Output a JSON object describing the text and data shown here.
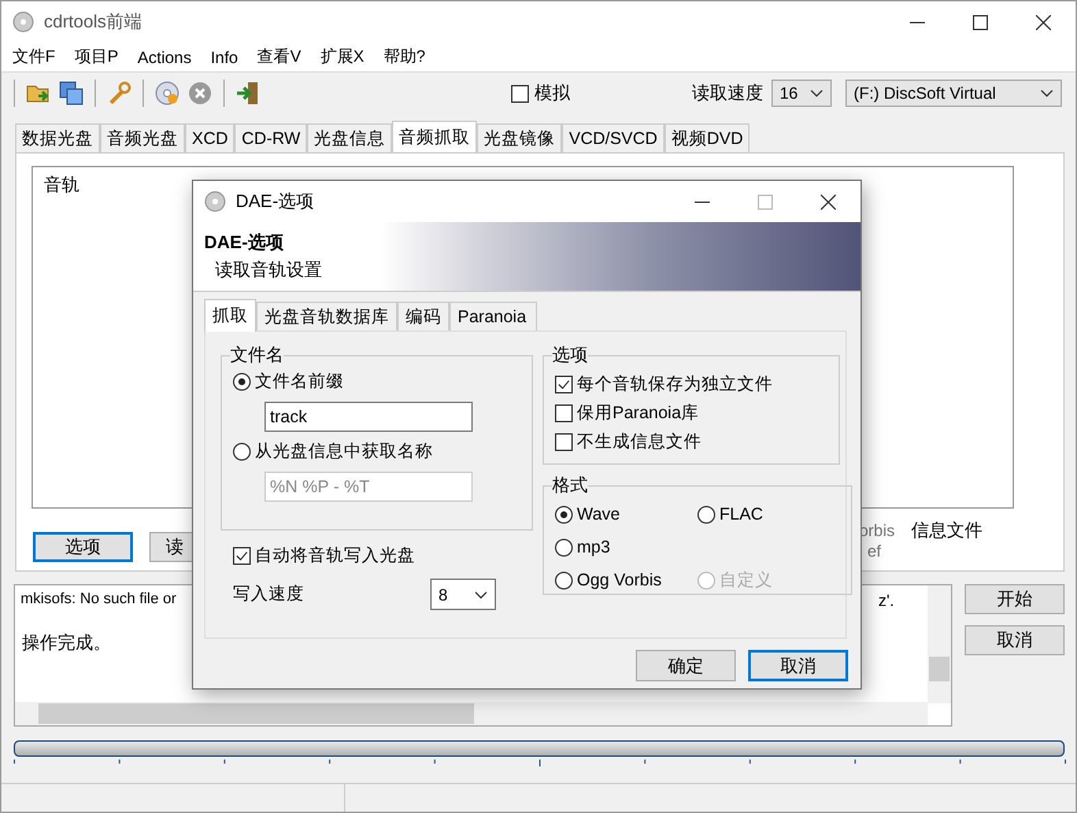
{
  "window": {
    "title": "cdrtools前端"
  },
  "menu": [
    "文件F",
    "项目P",
    "Actions",
    "Info",
    "查看V",
    "扩展X",
    "帮助?"
  ],
  "toolbar": {
    "simulate": {
      "label": "模拟",
      "checked": false
    },
    "read_speed": {
      "label": "读取速度",
      "value": "16"
    },
    "drive": {
      "value": "(F:) DiscSoft Virtual"
    }
  },
  "tabs": [
    {
      "label": "数据光盘",
      "selected": false
    },
    {
      "label": "音频光盘",
      "selected": false
    },
    {
      "label": "XCD",
      "selected": false
    },
    {
      "label": "CD-RW",
      "selected": false
    },
    {
      "label": "光盘信息",
      "selected": false
    },
    {
      "label": "音频抓取",
      "selected": true
    },
    {
      "label": "光盘镜像",
      "selected": false
    },
    {
      "label": "VCD/SVCD",
      "selected": false
    },
    {
      "label": "视频DVD",
      "selected": false
    }
  ],
  "track_list": {
    "column_1": "音轨",
    "fragments": [
      "orbis",
      "信息文件",
      "ef"
    ]
  },
  "buttons": [
    {
      "label": "选项",
      "focused": true
    },
    {
      "label": "读",
      "focused": false
    }
  ],
  "log": {
    "lines": [
      "mkisofs: No such file or",
      "操作完成。"
    ],
    "fragment": "z'."
  },
  "side_buttons": [
    "开始",
    "取消"
  ],
  "progress": {
    "level": 0
  },
  "dialog": {
    "title": "DAE-选项",
    "heading": "DAE-选项",
    "subheading": "读取音轨设置",
    "tabs": [
      {
        "label": "抓取",
        "selected": true
      },
      {
        "label": "光盘音轨数据库",
        "selected": false
      },
      {
        "label": "编码",
        "selected": false
      },
      {
        "label": "Paranoia",
        "selected": false
      }
    ],
    "filename_group": {
      "title": "文件名",
      "options": [
        {
          "label": "文件名前缀",
          "selected": true,
          "value": "track",
          "disabled": false
        },
        {
          "label": "从光盘信息中获取名称",
          "selected": false,
          "value": "%N %P - %T",
          "disabled": true
        }
      ]
    },
    "auto_write": {
      "label": "自动将音轨写入光盘",
      "checked": true
    },
    "write_speed": {
      "label": "写入速度",
      "value": "8"
    },
    "options_group": {
      "title": "选项",
      "items": [
        {
          "label": "每个音轨保存为独立文件",
          "checked": true
        },
        {
          "label": "保用Paranoia库",
          "checked": false
        },
        {
          "label": "不生成信息文件",
          "checked": false
        }
      ]
    },
    "format_group": {
      "title": "格式",
      "rows": [
        [
          {
            "label": "Wave",
            "selected": true,
            "disabled": false
          },
          {
            "label": "FLAC",
            "selected": false,
            "disabled": false
          }
        ],
        [
          {
            "label": "mp3",
            "selected": false,
            "disabled": false
          }
        ],
        [
          {
            "label": "Ogg Vorbis",
            "selected": false,
            "disabled": false
          },
          {
            "label": "自定义",
            "selected": false,
            "disabled": true
          }
        ]
      ]
    },
    "buttons": [
      {
        "label": "确定",
        "default": false
      },
      {
        "label": "取消",
        "default": true
      }
    ]
  }
}
